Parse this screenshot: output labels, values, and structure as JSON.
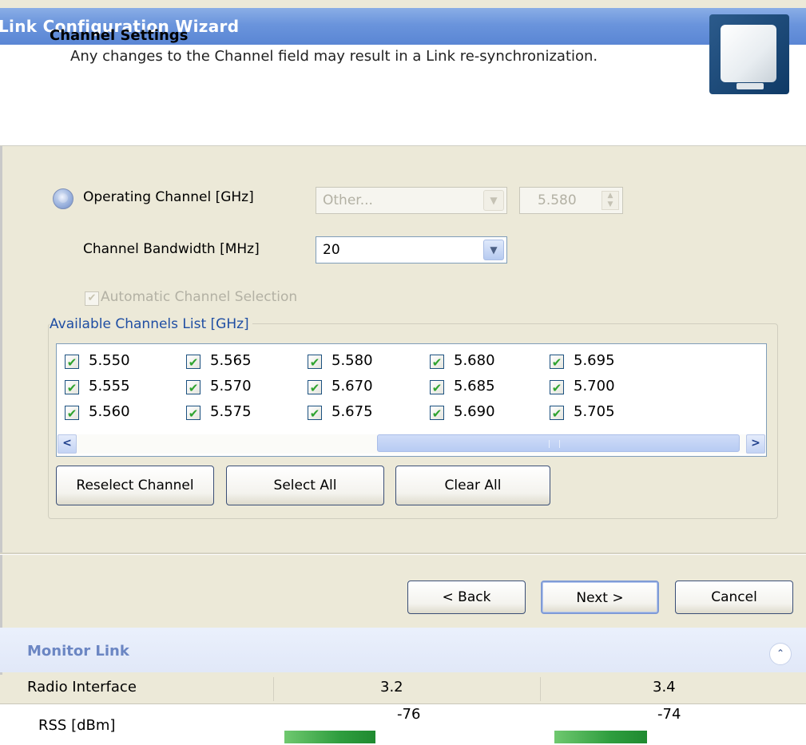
{
  "window": {
    "title": "Link Configuration Wizard"
  },
  "header": {
    "title": "Channel Settings",
    "subtitle": "Any changes to the Channel field may result in a Link re-synchronization."
  },
  "operating_channel": {
    "label": "Operating Channel [GHz]",
    "combo_value": "Other...",
    "spin_value": "5.580"
  },
  "bandwidth": {
    "label": "Channel Bandwidth [MHz]",
    "value": "20"
  },
  "auto_selection": {
    "label": "Automatic Channel Selection",
    "checked": true
  },
  "channels": {
    "group_title": "Available Channels List [GHz]",
    "columns": [
      [
        "5.550",
        "5.555",
        "5.560"
      ],
      [
        "5.565",
        "5.570",
        "5.575"
      ],
      [
        "5.580",
        "5.670",
        "5.675"
      ],
      [
        "5.680",
        "5.685",
        "5.690"
      ],
      [
        "5.695",
        "5.700",
        "5.705"
      ]
    ],
    "checked_mark": "✔"
  },
  "buttons": {
    "reselect": "Reselect Channel",
    "select_all": "Select All",
    "clear_all": "Clear All",
    "back": "< Back",
    "next": "Next >",
    "cancel": "Cancel"
  },
  "monitor": {
    "title": "Monitor Link",
    "rows": {
      "radio_interface": {
        "label": "Radio Interface",
        "v1": "3.2",
        "v2": "3.4"
      },
      "rss": {
        "label": "RSS [dBm]",
        "v1": "-76",
        "v2": "-74"
      }
    }
  }
}
